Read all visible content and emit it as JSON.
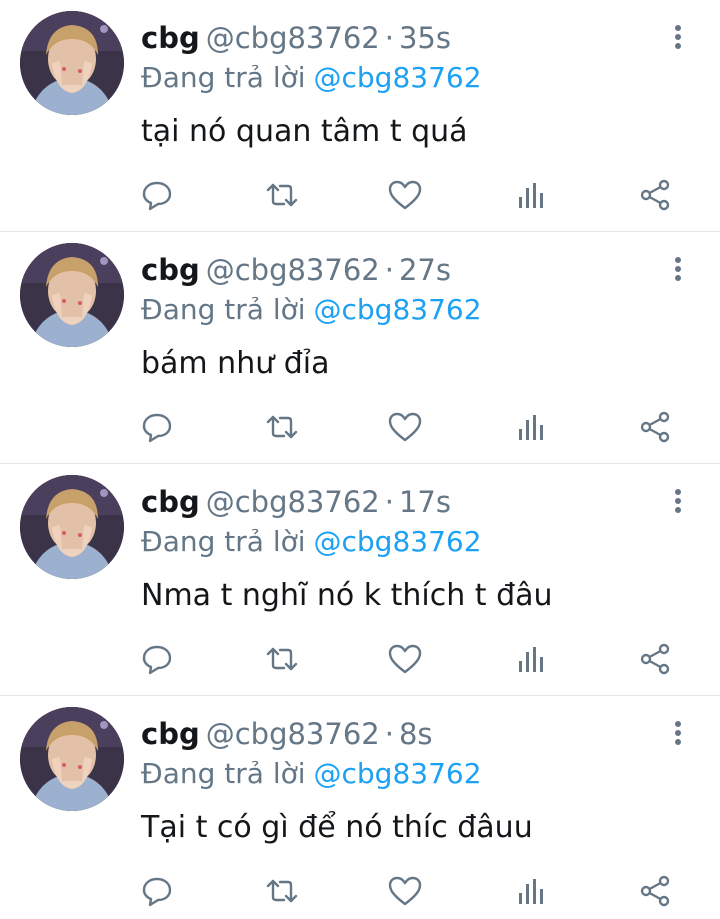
{
  "colors": {
    "name": "#14171a",
    "muted": "#657786",
    "link": "#1da1f2",
    "icon": "#657786",
    "divider": "#e1e6ea"
  },
  "tweets": [
    {
      "display_name": "cbg",
      "handle": "@cbg83762",
      "separator": "·",
      "time": "35s",
      "reply_prefix": "Đang trả lời",
      "reply_to": "@cbg83762",
      "text": "tại nó quan tâm t quá"
    },
    {
      "display_name": "cbg",
      "handle": "@cbg83762",
      "separator": "·",
      "time": "27s",
      "reply_prefix": "Đang trả lời",
      "reply_to": "@cbg83762",
      "text": "bám như đỉa"
    },
    {
      "display_name": "cbg",
      "handle": "@cbg83762",
      "separator": "·",
      "time": "17s",
      "reply_prefix": "Đang trả lời",
      "reply_to": "@cbg83762",
      "text": "Nma t nghĩ nó k thích t đâu"
    },
    {
      "display_name": "cbg",
      "handle": "@cbg83762",
      "separator": "·",
      "time": "8s",
      "reply_prefix": "Đang trả lời",
      "reply_to": "@cbg83762",
      "text": "Tại t có gì để nó thíc đâuu"
    }
  ],
  "icons": {
    "more": "more-vertical-icon",
    "reply": "reply-icon",
    "retweet": "retweet-icon",
    "like": "heart-icon",
    "analytics": "analytics-icon",
    "share": "share-icon"
  }
}
